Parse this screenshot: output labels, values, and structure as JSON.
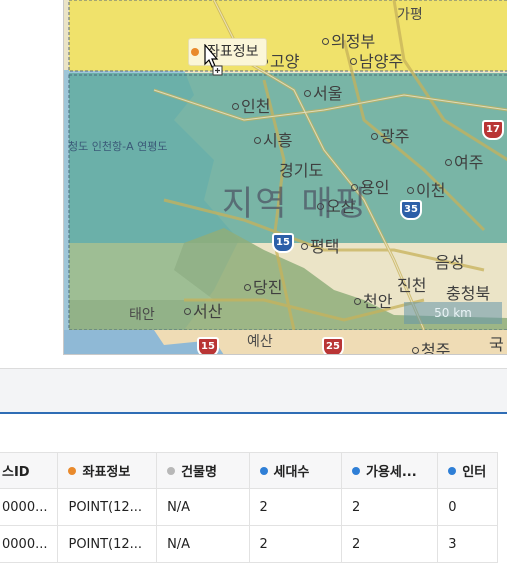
{
  "map": {
    "title": "지역 매핑",
    "coast_label": "청도 인천항-A 연평도",
    "scale_label": "50 km",
    "places": [
      {
        "name": "가평",
        "dot": false
      },
      {
        "name": "의정부",
        "dot": true
      },
      {
        "name": "남양주",
        "dot": true
      },
      {
        "name": "고양",
        "dot": true
      },
      {
        "name": "서울",
        "dot": true
      },
      {
        "name": "인천",
        "dot": true
      },
      {
        "name": "시흥",
        "dot": true
      },
      {
        "name": "광주",
        "dot": true
      },
      {
        "name": "여주",
        "dot": true
      },
      {
        "name": "경기도",
        "dot": false
      },
      {
        "name": "용인",
        "dot": true
      },
      {
        "name": "이천",
        "dot": true
      },
      {
        "name": "오산",
        "dot": true
      },
      {
        "name": "평택",
        "dot": true
      },
      {
        "name": "음성",
        "dot": false
      },
      {
        "name": "진천",
        "dot": false
      },
      {
        "name": "당진",
        "dot": true
      },
      {
        "name": "충청북",
        "dot": false
      },
      {
        "name": "서산",
        "dot": true
      },
      {
        "name": "천안",
        "dot": true
      },
      {
        "name": "태안",
        "dot": false
      },
      {
        "name": "예산",
        "dot": false
      },
      {
        "name": "청주",
        "dot": true
      },
      {
        "name": "국",
        "dot": false
      }
    ],
    "highways": [
      "17",
      "15",
      "35",
      "15",
      "25"
    ],
    "tooltip": {
      "label": "좌표정보",
      "bullet_color": "#e98a2c"
    },
    "region_colors": {
      "north": "#f3e45a",
      "central": "#6fb3a8",
      "south": "#a8b98a"
    }
  },
  "table": {
    "columns": [
      {
        "label": "스ID",
        "dot_color": ""
      },
      {
        "label": "좌표정보",
        "dot_color": "#e98a2c"
      },
      {
        "label": "건물명",
        "dot_color": "#b8b8b8"
      },
      {
        "label": "세대수",
        "dot_color": "#2f7fd6"
      },
      {
        "label": "가용세...",
        "dot_color": "#2f7fd6"
      },
      {
        "label": "인터",
        "dot_color": "#2f7fd6"
      }
    ],
    "rows": [
      [
        "0000...",
        "POINT(12...",
        "N/A",
        "2",
        "2",
        "0"
      ],
      [
        "0000...",
        "POINT(12...",
        "N/A",
        "2",
        "2",
        "3"
      ]
    ]
  }
}
